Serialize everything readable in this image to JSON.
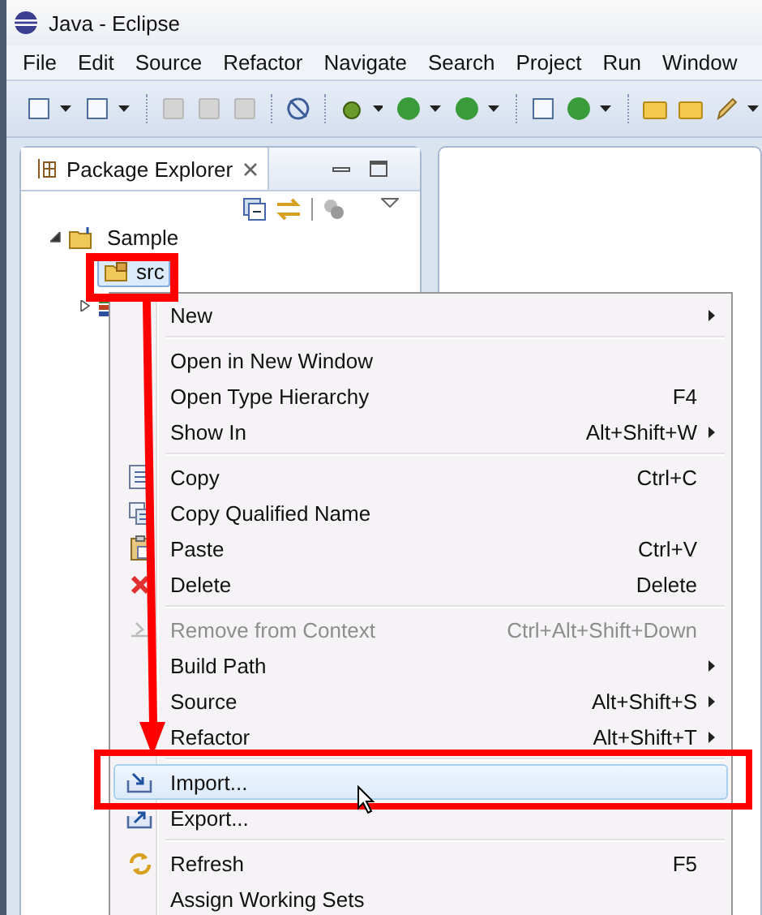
{
  "window": {
    "title": "Java - Eclipse"
  },
  "menubar": [
    "File",
    "Edit",
    "Source",
    "Refactor",
    "Navigate",
    "Search",
    "Project",
    "Run",
    "Window"
  ],
  "view": {
    "title": "Package Explorer"
  },
  "tree": [
    {
      "label": "Sample",
      "expanded": true,
      "selected": false,
      "children": [
        {
          "label": "src",
          "selected": true
        },
        {
          "expanded": false
        }
      ]
    }
  ],
  "context_menu": [
    {
      "kind": "item",
      "label": "New",
      "submenu": true,
      "disabled": false,
      "selected": false
    },
    {
      "kind": "separator"
    },
    {
      "kind": "item",
      "label": "Open in New Window",
      "submenu": false,
      "disabled": false,
      "selected": false
    },
    {
      "kind": "item",
      "label": "Open Type Hierarchy",
      "shortcut": "F4",
      "submenu": false,
      "disabled": false,
      "selected": false
    },
    {
      "kind": "item",
      "label": "Show In",
      "shortcut": "Alt+Shift+W",
      "submenu": true,
      "disabled": false,
      "selected": false
    },
    {
      "kind": "separator"
    },
    {
      "kind": "item",
      "label": "Copy",
      "shortcut": "Ctrl+C",
      "submenu": false,
      "disabled": false,
      "selected": false
    },
    {
      "kind": "item",
      "label": "Copy Qualified Name",
      "submenu": false,
      "disabled": false,
      "selected": false
    },
    {
      "kind": "item",
      "label": "Paste",
      "shortcut": "Ctrl+V",
      "submenu": false,
      "disabled": false,
      "selected": false
    },
    {
      "kind": "item",
      "label": "Delete",
      "shortcut": "Delete",
      "submenu": false,
      "disabled": false,
      "selected": false
    },
    {
      "kind": "separator"
    },
    {
      "kind": "item",
      "label": "Remove from Context",
      "shortcut": "Ctrl+Alt+Shift+Down",
      "submenu": false,
      "disabled": true,
      "selected": false
    },
    {
      "kind": "item",
      "label": "Build Path",
      "submenu": true,
      "disabled": false,
      "selected": false
    },
    {
      "kind": "item",
      "label": "Source",
      "shortcut": "Alt+Shift+S",
      "submenu": true,
      "disabled": false,
      "selected": false
    },
    {
      "kind": "item",
      "label": "Refactor",
      "shortcut": "Alt+Shift+T",
      "submenu": true,
      "disabled": false,
      "selected": false
    },
    {
      "kind": "separator"
    },
    {
      "kind": "item",
      "label": "Import...",
      "submenu": false,
      "disabled": false,
      "selected": true
    },
    {
      "kind": "item",
      "label": "Export...",
      "submenu": false,
      "disabled": false,
      "selected": false
    },
    {
      "kind": "separator"
    },
    {
      "kind": "item",
      "label": "Refresh",
      "shortcut": "F5",
      "submenu": false,
      "disabled": false,
      "selected": false
    },
    {
      "kind": "item",
      "label": "Assign Working Sets",
      "submenu": false,
      "disabled": false,
      "selected": false
    }
  ]
}
